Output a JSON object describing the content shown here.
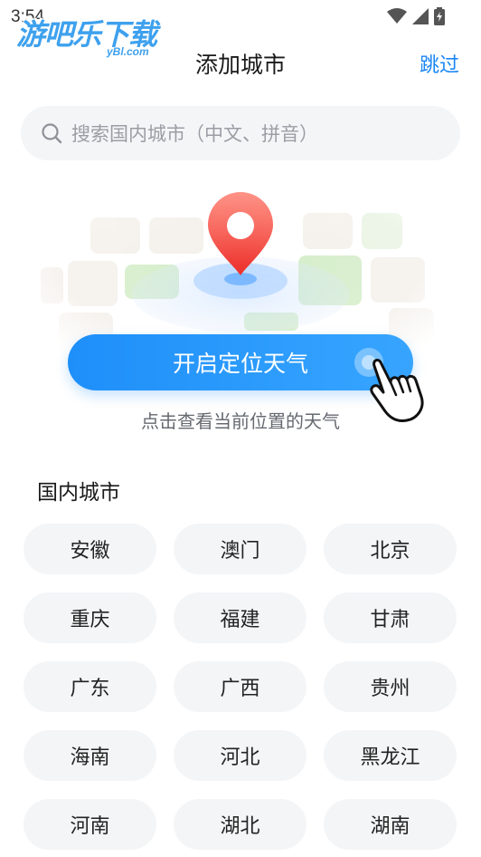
{
  "status_bar": {
    "time": "3:54"
  },
  "watermark": {
    "brand": "游吧乐下载",
    "domain": "yBl.com"
  },
  "header": {
    "title": "添加城市",
    "skip_label": "跳过"
  },
  "search": {
    "placeholder": "搜索国内城市（中文、拼音）"
  },
  "location": {
    "button_label": "开启定位天气",
    "hint": "点击查看当前位置的天气"
  },
  "domestic": {
    "title": "国内城市",
    "cities": [
      "安徽",
      "澳门",
      "北京",
      "重庆",
      "福建",
      "甘肃",
      "广东",
      "广西",
      "贵州",
      "海南",
      "河北",
      "黑龙江",
      "河南",
      "湖北",
      "湖南"
    ]
  },
  "colors": {
    "accent": "#1a87f5",
    "button_start": "#1e8ff9",
    "button_end": "#37a5ff",
    "chip_bg": "#f4f5f7"
  }
}
